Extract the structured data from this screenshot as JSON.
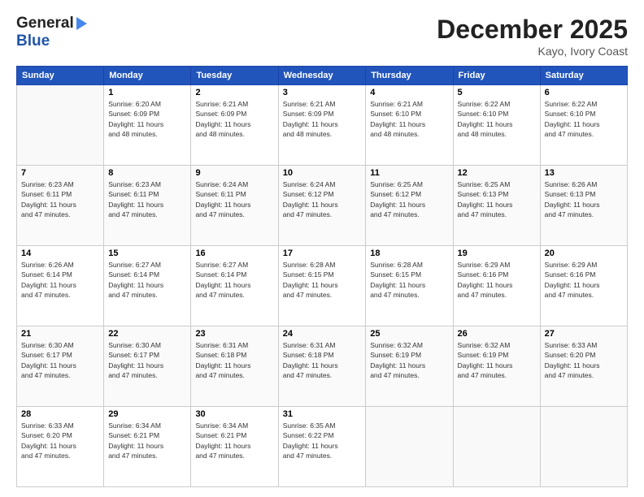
{
  "header": {
    "logo_line1": "General",
    "logo_line2": "Blue",
    "month": "December 2025",
    "location": "Kayo, Ivory Coast"
  },
  "weekdays": [
    "Sunday",
    "Monday",
    "Tuesday",
    "Wednesday",
    "Thursday",
    "Friday",
    "Saturday"
  ],
  "weeks": [
    [
      {
        "day": "",
        "info": ""
      },
      {
        "day": "1",
        "info": "Sunrise: 6:20 AM\nSunset: 6:09 PM\nDaylight: 11 hours\nand 48 minutes."
      },
      {
        "day": "2",
        "info": "Sunrise: 6:21 AM\nSunset: 6:09 PM\nDaylight: 11 hours\nand 48 minutes."
      },
      {
        "day": "3",
        "info": "Sunrise: 6:21 AM\nSunset: 6:09 PM\nDaylight: 11 hours\nand 48 minutes."
      },
      {
        "day": "4",
        "info": "Sunrise: 6:21 AM\nSunset: 6:10 PM\nDaylight: 11 hours\nand 48 minutes."
      },
      {
        "day": "5",
        "info": "Sunrise: 6:22 AM\nSunset: 6:10 PM\nDaylight: 11 hours\nand 48 minutes."
      },
      {
        "day": "6",
        "info": "Sunrise: 6:22 AM\nSunset: 6:10 PM\nDaylight: 11 hours\nand 47 minutes."
      }
    ],
    [
      {
        "day": "7",
        "info": "Sunrise: 6:23 AM\nSunset: 6:11 PM\nDaylight: 11 hours\nand 47 minutes."
      },
      {
        "day": "8",
        "info": "Sunrise: 6:23 AM\nSunset: 6:11 PM\nDaylight: 11 hours\nand 47 minutes."
      },
      {
        "day": "9",
        "info": "Sunrise: 6:24 AM\nSunset: 6:11 PM\nDaylight: 11 hours\nand 47 minutes."
      },
      {
        "day": "10",
        "info": "Sunrise: 6:24 AM\nSunset: 6:12 PM\nDaylight: 11 hours\nand 47 minutes."
      },
      {
        "day": "11",
        "info": "Sunrise: 6:25 AM\nSunset: 6:12 PM\nDaylight: 11 hours\nand 47 minutes."
      },
      {
        "day": "12",
        "info": "Sunrise: 6:25 AM\nSunset: 6:13 PM\nDaylight: 11 hours\nand 47 minutes."
      },
      {
        "day": "13",
        "info": "Sunrise: 6:26 AM\nSunset: 6:13 PM\nDaylight: 11 hours\nand 47 minutes."
      }
    ],
    [
      {
        "day": "14",
        "info": "Sunrise: 6:26 AM\nSunset: 6:14 PM\nDaylight: 11 hours\nand 47 minutes."
      },
      {
        "day": "15",
        "info": "Sunrise: 6:27 AM\nSunset: 6:14 PM\nDaylight: 11 hours\nand 47 minutes."
      },
      {
        "day": "16",
        "info": "Sunrise: 6:27 AM\nSunset: 6:14 PM\nDaylight: 11 hours\nand 47 minutes."
      },
      {
        "day": "17",
        "info": "Sunrise: 6:28 AM\nSunset: 6:15 PM\nDaylight: 11 hours\nand 47 minutes."
      },
      {
        "day": "18",
        "info": "Sunrise: 6:28 AM\nSunset: 6:15 PM\nDaylight: 11 hours\nand 47 minutes."
      },
      {
        "day": "19",
        "info": "Sunrise: 6:29 AM\nSunset: 6:16 PM\nDaylight: 11 hours\nand 47 minutes."
      },
      {
        "day": "20",
        "info": "Sunrise: 6:29 AM\nSunset: 6:16 PM\nDaylight: 11 hours\nand 47 minutes."
      }
    ],
    [
      {
        "day": "21",
        "info": "Sunrise: 6:30 AM\nSunset: 6:17 PM\nDaylight: 11 hours\nand 47 minutes."
      },
      {
        "day": "22",
        "info": "Sunrise: 6:30 AM\nSunset: 6:17 PM\nDaylight: 11 hours\nand 47 minutes."
      },
      {
        "day": "23",
        "info": "Sunrise: 6:31 AM\nSunset: 6:18 PM\nDaylight: 11 hours\nand 47 minutes."
      },
      {
        "day": "24",
        "info": "Sunrise: 6:31 AM\nSunset: 6:18 PM\nDaylight: 11 hours\nand 47 minutes."
      },
      {
        "day": "25",
        "info": "Sunrise: 6:32 AM\nSunset: 6:19 PM\nDaylight: 11 hours\nand 47 minutes."
      },
      {
        "day": "26",
        "info": "Sunrise: 6:32 AM\nSunset: 6:19 PM\nDaylight: 11 hours\nand 47 minutes."
      },
      {
        "day": "27",
        "info": "Sunrise: 6:33 AM\nSunset: 6:20 PM\nDaylight: 11 hours\nand 47 minutes."
      }
    ],
    [
      {
        "day": "28",
        "info": "Sunrise: 6:33 AM\nSunset: 6:20 PM\nDaylight: 11 hours\nand 47 minutes."
      },
      {
        "day": "29",
        "info": "Sunrise: 6:34 AM\nSunset: 6:21 PM\nDaylight: 11 hours\nand 47 minutes."
      },
      {
        "day": "30",
        "info": "Sunrise: 6:34 AM\nSunset: 6:21 PM\nDaylight: 11 hours\nand 47 minutes."
      },
      {
        "day": "31",
        "info": "Sunrise: 6:35 AM\nSunset: 6:22 PM\nDaylight: 11 hours\nand 47 minutes."
      },
      {
        "day": "",
        "info": ""
      },
      {
        "day": "",
        "info": ""
      },
      {
        "day": "",
        "info": ""
      }
    ]
  ]
}
